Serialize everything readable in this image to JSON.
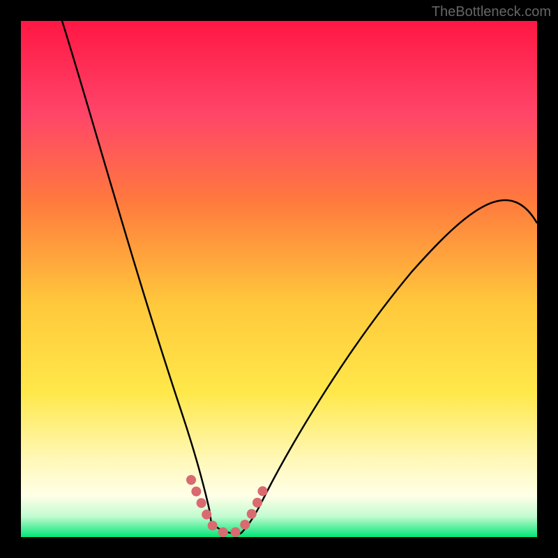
{
  "watermark": "TheBottleneck.com",
  "chart_data": {
    "type": "line",
    "title": "",
    "xlabel": "",
    "ylabel": "",
    "xlim": [
      0,
      100
    ],
    "ylim": [
      0,
      100
    ],
    "series": [
      {
        "name": "curve-left",
        "x": [
          8,
          12,
          16,
          20,
          24,
          28,
          31,
          33,
          35,
          36.5
        ],
        "values": [
          100,
          85,
          70,
          55,
          40,
          25,
          12,
          6,
          2,
          0
        ]
      },
      {
        "name": "curve-right",
        "x": [
          43,
          45,
          48,
          52,
          58,
          65,
          73,
          82,
          92,
          100
        ],
        "values": [
          0,
          2,
          6,
          12,
          20,
          29,
          38,
          47,
          55,
          61
        ]
      },
      {
        "name": "highlight-band",
        "type": "marker",
        "x": [
          33,
          34,
          35,
          36,
          37,
          38,
          39,
          40,
          41,
          42,
          43,
          44,
          45,
          46,
          47
        ],
        "values": [
          8,
          5,
          2.5,
          1,
          0.3,
          0,
          0,
          0,
          0,
          0.3,
          1,
          2.5,
          5,
          7,
          9
        ]
      }
    ],
    "gradient_colors": {
      "top": "#FF1744",
      "upper_mid": "#FF6D3A",
      "mid": "#FFD740",
      "lower_mid": "#FFF176",
      "near_bottom": "#FFFDE7",
      "bottom": "#00E676"
    },
    "highlight_color": "#D96A6F"
  }
}
